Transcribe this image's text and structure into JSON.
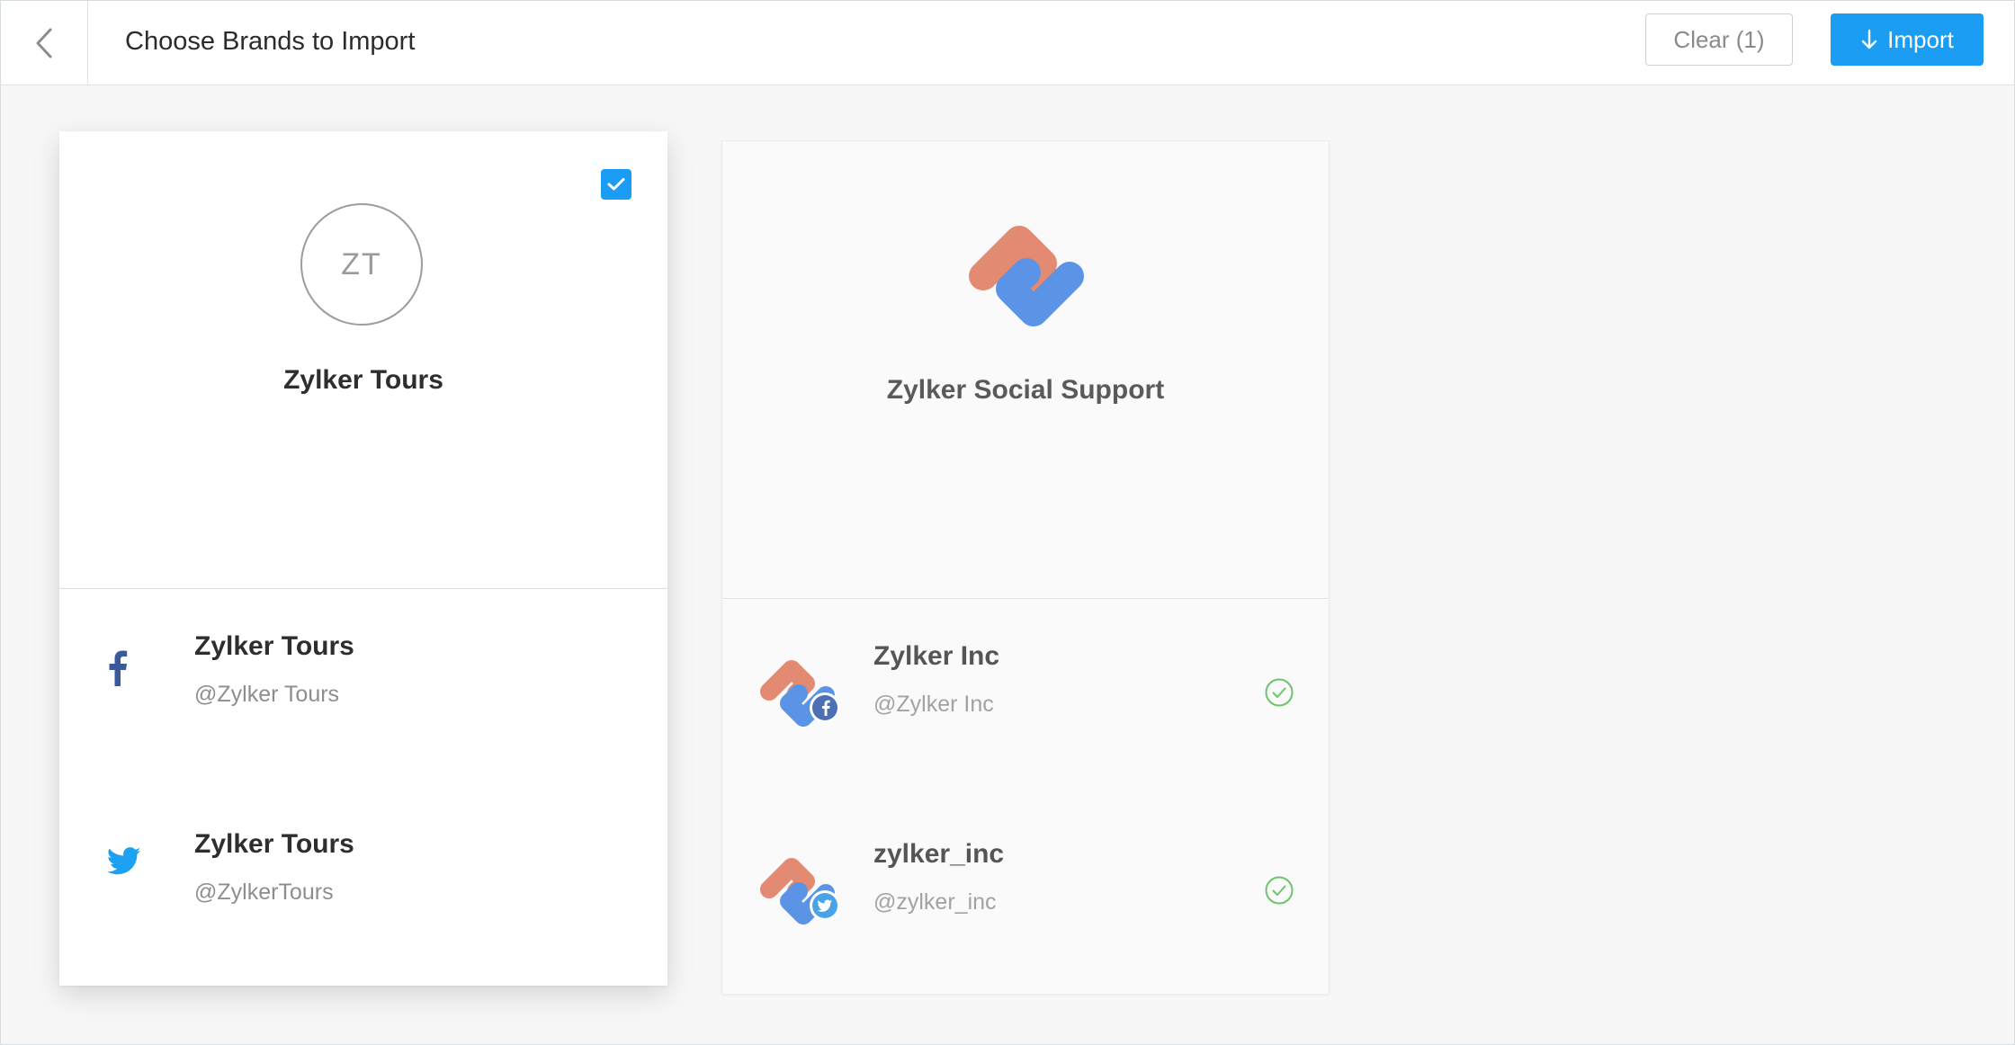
{
  "header": {
    "title": "Choose Brands to Import",
    "clear_label": "Clear (1)",
    "import_label": "Import"
  },
  "brands": [
    {
      "name": "Zylker Tours",
      "initials": "ZT",
      "selected": true,
      "accounts": [
        {
          "network": "facebook",
          "name": "Zylker Tours",
          "handle": "@Zylker Tours"
        },
        {
          "network": "twitter",
          "name": "Zylker Tours",
          "handle": "@ZylkerTours"
        }
      ]
    },
    {
      "name": "Zylker Social Support",
      "selected": false,
      "accounts": [
        {
          "network": "facebook",
          "name": "Zylker Inc",
          "handle": "@Zylker Inc",
          "imported": true
        },
        {
          "network": "twitter",
          "name": "zylker_inc",
          "handle": "@zylker_inc",
          "imported": true
        }
      ]
    }
  ],
  "colors": {
    "accent": "#1a9df3",
    "facebook": "#3b5998",
    "twitter": "#1da1f2",
    "logo_orange": "#e38a72",
    "logo_blue": "#5b93e6",
    "check_green": "#6cc46c"
  }
}
